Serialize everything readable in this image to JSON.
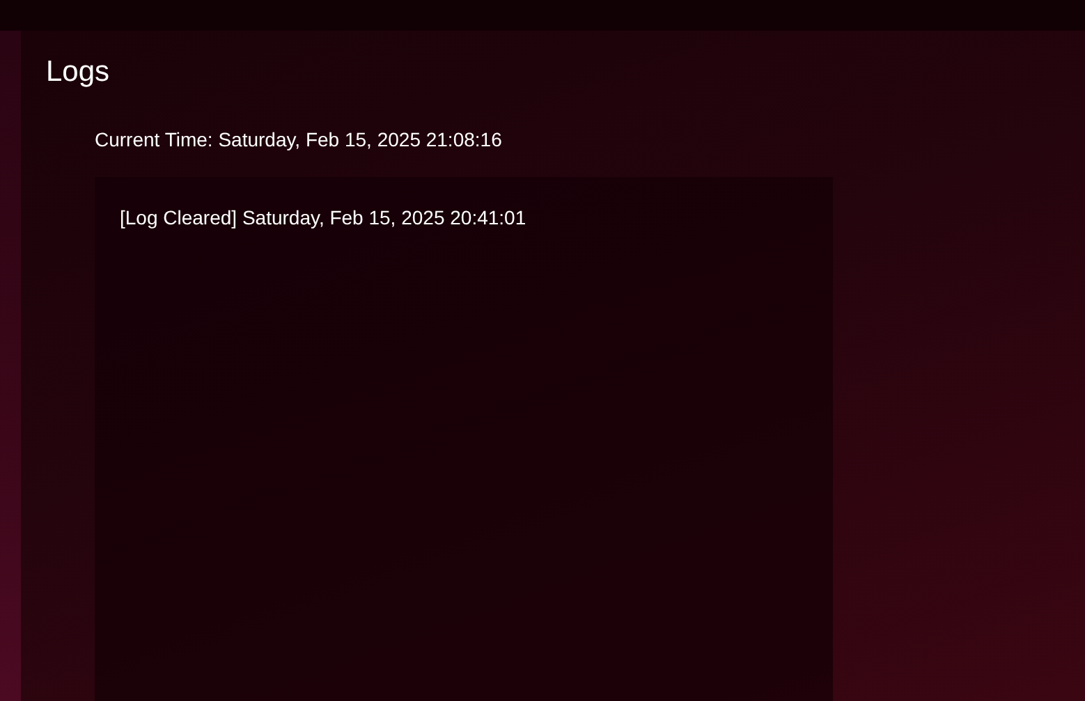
{
  "page": {
    "title": "Logs"
  },
  "current_time": "Current Time: Saturday, Feb 15, 2025 21:08:16",
  "log_entries": [
    "[Log Cleared] Saturday, Feb 15, 2025 20:41:01"
  ]
}
